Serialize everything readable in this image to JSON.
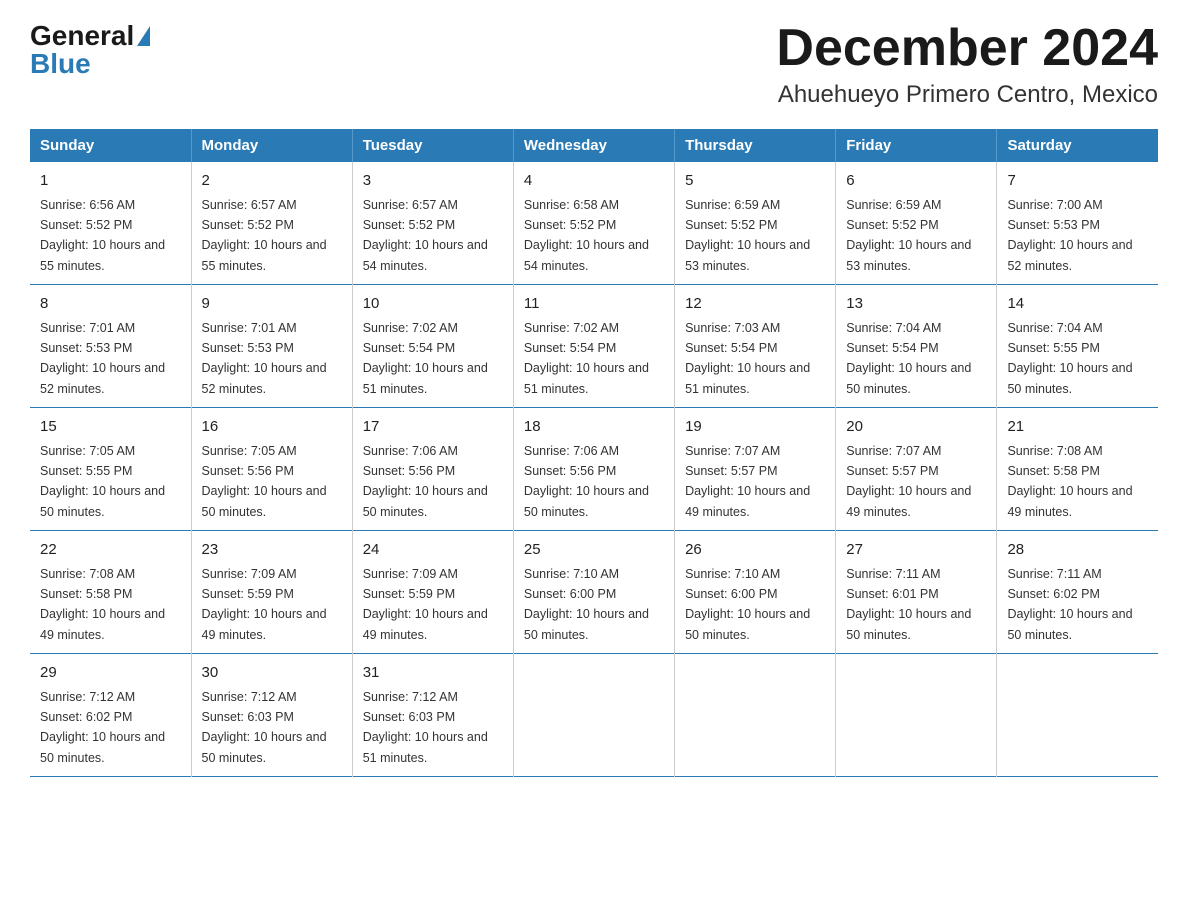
{
  "header": {
    "logo_general": "General",
    "logo_blue": "Blue",
    "title": "December 2024",
    "subtitle": "Ahuehueyo Primero Centro, Mexico"
  },
  "days_of_week": [
    "Sunday",
    "Monday",
    "Tuesday",
    "Wednesday",
    "Thursday",
    "Friday",
    "Saturday"
  ],
  "weeks": [
    [
      {
        "day": "1",
        "sunrise": "6:56 AM",
        "sunset": "5:52 PM",
        "daylight": "10 hours and 55 minutes."
      },
      {
        "day": "2",
        "sunrise": "6:57 AM",
        "sunset": "5:52 PM",
        "daylight": "10 hours and 55 minutes."
      },
      {
        "day": "3",
        "sunrise": "6:57 AM",
        "sunset": "5:52 PM",
        "daylight": "10 hours and 54 minutes."
      },
      {
        "day": "4",
        "sunrise": "6:58 AM",
        "sunset": "5:52 PM",
        "daylight": "10 hours and 54 minutes."
      },
      {
        "day": "5",
        "sunrise": "6:59 AM",
        "sunset": "5:52 PM",
        "daylight": "10 hours and 53 minutes."
      },
      {
        "day": "6",
        "sunrise": "6:59 AM",
        "sunset": "5:52 PM",
        "daylight": "10 hours and 53 minutes."
      },
      {
        "day": "7",
        "sunrise": "7:00 AM",
        "sunset": "5:53 PM",
        "daylight": "10 hours and 52 minutes."
      }
    ],
    [
      {
        "day": "8",
        "sunrise": "7:01 AM",
        "sunset": "5:53 PM",
        "daylight": "10 hours and 52 minutes."
      },
      {
        "day": "9",
        "sunrise": "7:01 AM",
        "sunset": "5:53 PM",
        "daylight": "10 hours and 52 minutes."
      },
      {
        "day": "10",
        "sunrise": "7:02 AM",
        "sunset": "5:54 PM",
        "daylight": "10 hours and 51 minutes."
      },
      {
        "day": "11",
        "sunrise": "7:02 AM",
        "sunset": "5:54 PM",
        "daylight": "10 hours and 51 minutes."
      },
      {
        "day": "12",
        "sunrise": "7:03 AM",
        "sunset": "5:54 PM",
        "daylight": "10 hours and 51 minutes."
      },
      {
        "day": "13",
        "sunrise": "7:04 AM",
        "sunset": "5:54 PM",
        "daylight": "10 hours and 50 minutes."
      },
      {
        "day": "14",
        "sunrise": "7:04 AM",
        "sunset": "5:55 PM",
        "daylight": "10 hours and 50 minutes."
      }
    ],
    [
      {
        "day": "15",
        "sunrise": "7:05 AM",
        "sunset": "5:55 PM",
        "daylight": "10 hours and 50 minutes."
      },
      {
        "day": "16",
        "sunrise": "7:05 AM",
        "sunset": "5:56 PM",
        "daylight": "10 hours and 50 minutes."
      },
      {
        "day": "17",
        "sunrise": "7:06 AM",
        "sunset": "5:56 PM",
        "daylight": "10 hours and 50 minutes."
      },
      {
        "day": "18",
        "sunrise": "7:06 AM",
        "sunset": "5:56 PM",
        "daylight": "10 hours and 50 minutes."
      },
      {
        "day": "19",
        "sunrise": "7:07 AM",
        "sunset": "5:57 PM",
        "daylight": "10 hours and 49 minutes."
      },
      {
        "day": "20",
        "sunrise": "7:07 AM",
        "sunset": "5:57 PM",
        "daylight": "10 hours and 49 minutes."
      },
      {
        "day": "21",
        "sunrise": "7:08 AM",
        "sunset": "5:58 PM",
        "daylight": "10 hours and 49 minutes."
      }
    ],
    [
      {
        "day": "22",
        "sunrise": "7:08 AM",
        "sunset": "5:58 PM",
        "daylight": "10 hours and 49 minutes."
      },
      {
        "day": "23",
        "sunrise": "7:09 AM",
        "sunset": "5:59 PM",
        "daylight": "10 hours and 49 minutes."
      },
      {
        "day": "24",
        "sunrise": "7:09 AM",
        "sunset": "5:59 PM",
        "daylight": "10 hours and 49 minutes."
      },
      {
        "day": "25",
        "sunrise": "7:10 AM",
        "sunset": "6:00 PM",
        "daylight": "10 hours and 50 minutes."
      },
      {
        "day": "26",
        "sunrise": "7:10 AM",
        "sunset": "6:00 PM",
        "daylight": "10 hours and 50 minutes."
      },
      {
        "day": "27",
        "sunrise": "7:11 AM",
        "sunset": "6:01 PM",
        "daylight": "10 hours and 50 minutes."
      },
      {
        "day": "28",
        "sunrise": "7:11 AM",
        "sunset": "6:02 PM",
        "daylight": "10 hours and 50 minutes."
      }
    ],
    [
      {
        "day": "29",
        "sunrise": "7:12 AM",
        "sunset": "6:02 PM",
        "daylight": "10 hours and 50 minutes."
      },
      {
        "day": "30",
        "sunrise": "7:12 AM",
        "sunset": "6:03 PM",
        "daylight": "10 hours and 50 minutes."
      },
      {
        "day": "31",
        "sunrise": "7:12 AM",
        "sunset": "6:03 PM",
        "daylight": "10 hours and 51 minutes."
      },
      {
        "day": "",
        "sunrise": "",
        "sunset": "",
        "daylight": ""
      },
      {
        "day": "",
        "sunrise": "",
        "sunset": "",
        "daylight": ""
      },
      {
        "day": "",
        "sunrise": "",
        "sunset": "",
        "daylight": ""
      },
      {
        "day": "",
        "sunrise": "",
        "sunset": "",
        "daylight": ""
      }
    ]
  ],
  "labels": {
    "sunrise_prefix": "Sunrise: ",
    "sunset_prefix": "Sunset: ",
    "daylight_prefix": "Daylight: "
  }
}
